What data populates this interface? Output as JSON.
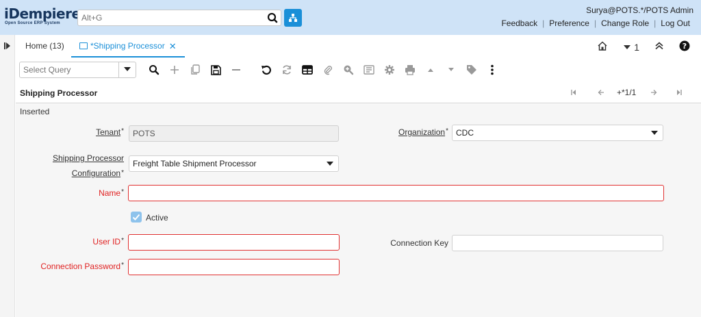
{
  "header": {
    "logo_main": "iDempiere",
    "logo_sub": "Open Source ERP System",
    "search_placeholder": "Alt+G",
    "user": "Surya@POTS.*/POTS Admin",
    "links": [
      "Feedback",
      "Preference",
      "Change Role",
      "Log Out"
    ]
  },
  "tabs": {
    "home_label": "Home (13)",
    "active_label": "*Shipping Processor",
    "close_glyph": "✕",
    "count_label": "1"
  },
  "toolbar": {
    "query_placeholder": "Select Query"
  },
  "titlebar": {
    "title": "Shipping Processor",
    "record_indicator": "+*1/1"
  },
  "form": {
    "status": "Inserted",
    "tenant": {
      "label": "Tenant",
      "value": "POTS"
    },
    "organization": {
      "label": "Organization",
      "value": "CDC"
    },
    "config": {
      "label_line1": "Shipping Processor",
      "label_line2": "Configuration",
      "value": "Freight Table Shipment Processor"
    },
    "name": {
      "label": "Name",
      "value": ""
    },
    "active": {
      "label": "Active",
      "checked": true
    },
    "user_id": {
      "label": "User ID",
      "value": ""
    },
    "connection_key": {
      "label": "Connection Key",
      "value": ""
    },
    "connection_password": {
      "label": "Connection Password",
      "value": ""
    },
    "required_mark": "*"
  },
  "colors": {
    "header_bg": "#cfe3f7",
    "accent": "#1a8fd8",
    "error": "#e02020",
    "form_bg": "#f6f6f6"
  },
  "icons": [
    "search-icon",
    "tree-icon",
    "toggle-icon",
    "home-icon",
    "chevron-down-icon",
    "double-chevron-up-icon",
    "help-icon",
    "magnify-icon",
    "plus-icon",
    "copy-icon",
    "save-icon",
    "minus-icon",
    "undo-icon",
    "refresh-icon",
    "grid-icon",
    "attachment-icon",
    "zoom-icon",
    "report-icon",
    "gear-icon",
    "print-icon",
    "arrow-up-icon",
    "arrow-down-icon",
    "tag-icon",
    "more-icon"
  ]
}
